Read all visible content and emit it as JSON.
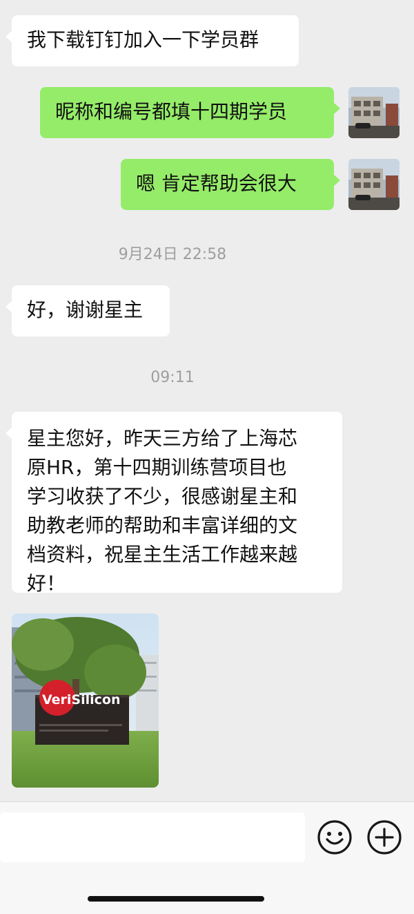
{
  "messages": [
    {
      "side": "incoming",
      "text": "我下载钉钉加入一下学员群"
    },
    {
      "side": "outgoing",
      "text": "昵称和编号都填十四期学员"
    },
    {
      "side": "outgoing",
      "text": "嗯 肯定帮助会很大"
    },
    {
      "side": "timestamp",
      "text": "9月24日 22:58"
    },
    {
      "side": "incoming",
      "text": "好，谢谢星主"
    },
    {
      "side": "timestamp",
      "text": "09:11"
    },
    {
      "side": "incoming",
      "lines": [
        "星主您好，昨天三方给了上海芯",
        "原HR，第十四期训练营项目也",
        "学习收获了不少，很感谢星主和",
        "助教老师的帮助和丰富详细的文",
        "档资料，祝星主生活工作越来越",
        "好！"
      ]
    },
    {
      "side": "incoming",
      "type": "image",
      "logo_text": "VeriSilicon"
    }
  ],
  "input_bar": {
    "text_value": "",
    "icons": [
      "emoji-icon",
      "plus-icon"
    ]
  },
  "colors": {
    "background": "#ededed",
    "incoming_bubble": "#ffffff",
    "outgoing_bubble": "#95ec69",
    "timestamp_text": "#9e9e9e"
  }
}
